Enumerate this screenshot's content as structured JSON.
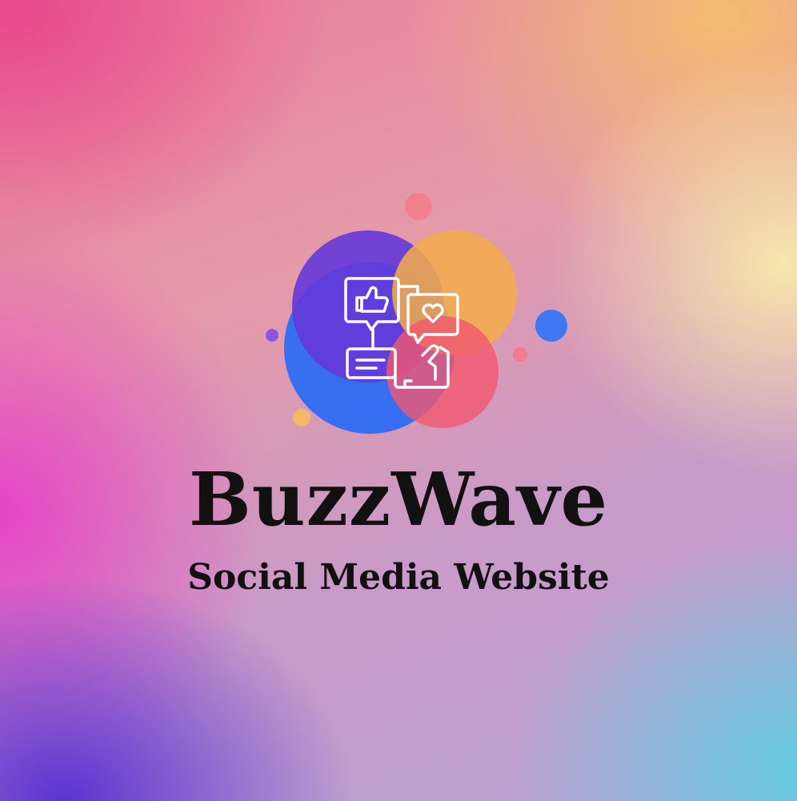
{
  "brand": {
    "name": "BuzzWave",
    "tagline": "Social Media Website",
    "logo_icon": "social-engagement-icon"
  },
  "colors": {
    "purple": "#5a2fd6",
    "blue": "#2d6cf5",
    "orange": "#f3ad4a",
    "coral": "#f06070",
    "pink": "#f2789a"
  }
}
